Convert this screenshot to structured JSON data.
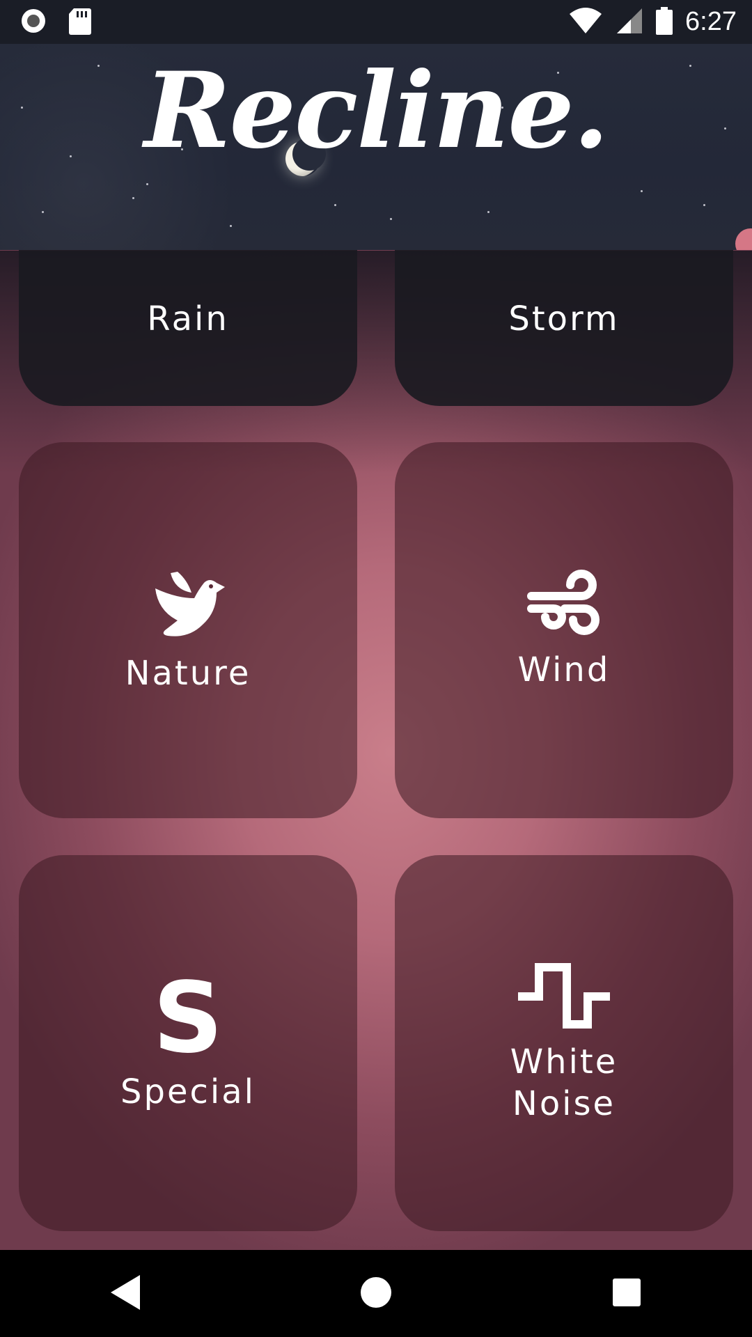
{
  "status_bar": {
    "time": "6:27",
    "left_icons": [
      "record-icon",
      "sd-card-icon"
    ],
    "right_icons": [
      "wifi-icon",
      "signal-icon",
      "battery-icon"
    ]
  },
  "header": {
    "logo_text": "Recline."
  },
  "tiles": [
    {
      "label": "Rain",
      "icon": "rain-icon"
    },
    {
      "label": "Storm",
      "icon": "storm-icon"
    },
    {
      "label": "Nature",
      "icon": "dove-icon"
    },
    {
      "label": "Wind",
      "icon": "wind-icon"
    },
    {
      "label": "Special",
      "icon": "special-s-icon",
      "glyph": "S"
    },
    {
      "label": "White\nNoise",
      "icon": "square-wave-icon"
    }
  ],
  "nav": [
    "back-icon",
    "home-icon",
    "recents-icon"
  ],
  "colors": {
    "header_bg": "#262b3a",
    "status_bar_bg": "#1a1d26",
    "accent_pink": "#c97e8a",
    "tile_dark": "#3c1923"
  }
}
